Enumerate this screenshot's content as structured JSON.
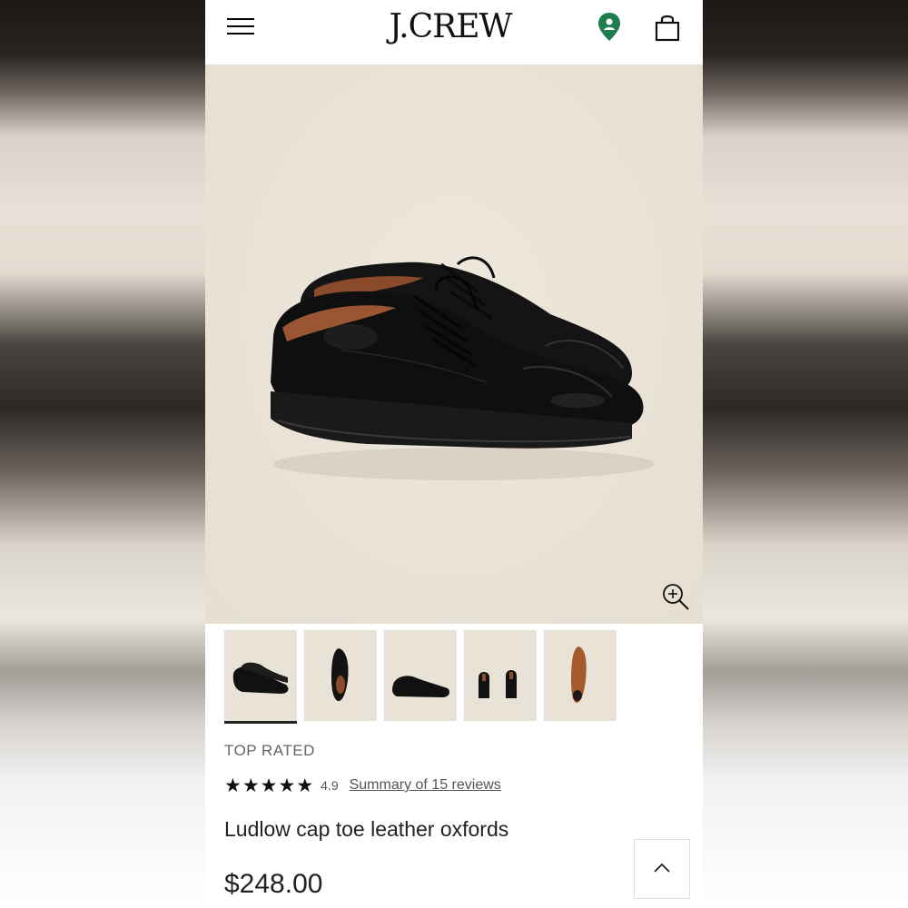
{
  "header": {
    "logo_text": "J.CREW",
    "icons": [
      "menu-icon",
      "location-pin-icon",
      "shopping-bag-icon"
    ],
    "pin_color": "#1e7d4f"
  },
  "gallery": {
    "thumbnails": [
      {
        "view": "pair-angle",
        "selected": true
      },
      {
        "view": "top-down",
        "selected": false
      },
      {
        "view": "side",
        "selected": false
      },
      {
        "view": "back",
        "selected": false
      },
      {
        "view": "sole",
        "selected": false
      }
    ],
    "zoom_icon": "zoom-in-icon"
  },
  "product": {
    "badge": "TOP RATED",
    "rating": "4.9",
    "stars": 5,
    "reviews_link": "Summary of 15 reviews",
    "name": "Ludlow cap toe leather oxfords",
    "price": "$248.00"
  },
  "scroll_top_icon": "chevron-up-icon"
}
